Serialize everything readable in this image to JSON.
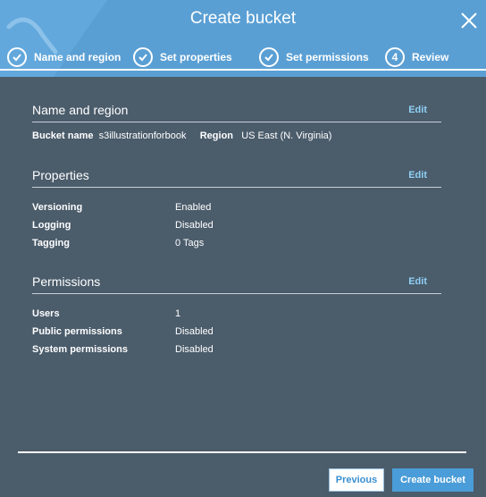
{
  "header": {
    "title": "Create bucket",
    "steps": [
      {
        "label": "Name and region",
        "state": "done"
      },
      {
        "label": "Set properties",
        "state": "done"
      },
      {
        "label": "Set permissions",
        "state": "done"
      },
      {
        "label": "Review",
        "number": "4",
        "state": "current"
      }
    ]
  },
  "name_region": {
    "title": "Name and region",
    "edit": "Edit",
    "bucket_name_key": "Bucket name",
    "bucket_name_val": "s3illustrationforbook",
    "region_key": "Region",
    "region_val": "US East (N. Virginia)"
  },
  "properties": {
    "title": "Properties",
    "edit": "Edit",
    "rows": [
      {
        "key": "Versioning",
        "val": "Enabled"
      },
      {
        "key": "Logging",
        "val": "Disabled"
      },
      {
        "key": "Tagging",
        "val": "0 Tags"
      }
    ]
  },
  "permissions": {
    "title": "Permissions",
    "edit": "Edit",
    "rows": [
      {
        "key": "Users",
        "val": "1"
      },
      {
        "key": "Public permissions",
        "val": "Disabled"
      },
      {
        "key": "System permissions",
        "val": "Disabled"
      }
    ]
  },
  "footer": {
    "previous": "Previous",
    "create": "Create bucket"
  },
  "colors": {
    "header": "#5a9fd4",
    "body": "#4b5c6b",
    "link": "#8fd0f5",
    "primary_button": "#4a9dd8"
  }
}
